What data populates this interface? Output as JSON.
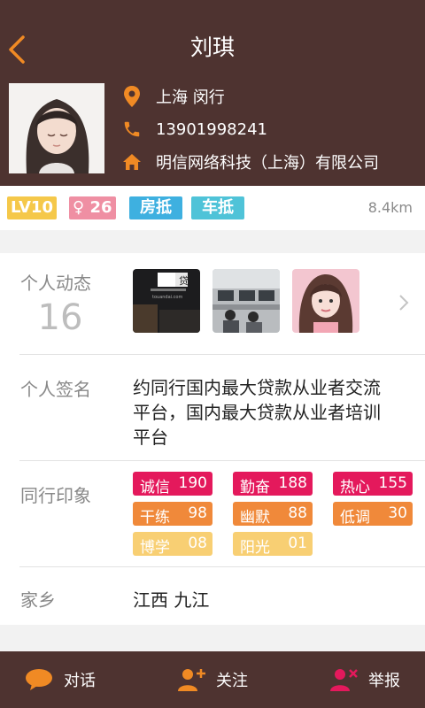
{
  "header": {
    "title": "刘琪"
  },
  "profile": {
    "location": "上海 闵行",
    "phone": "13901998241",
    "company": "明信网络科技（上海）有限公司"
  },
  "badges": {
    "level": "LV10",
    "gender_age": "♀ 26",
    "tag1": "房抵",
    "tag2": "车抵",
    "distance": "8.4km"
  },
  "activity": {
    "label": "个人动态",
    "count": "16",
    "thumb1_text": "贷",
    "thumb1_sub": "touandai.com"
  },
  "signature": {
    "label": "个人签名",
    "text": "约同行国内最大贷款从业者交流平台，国内最大贷款从业者培训平台"
  },
  "impressions": {
    "label": "同行印象",
    "tags": [
      {
        "name": "诚信",
        "count": "190",
        "color": "#e4195c"
      },
      {
        "name": "勤奋",
        "count": "188",
        "color": "#e4195c"
      },
      {
        "name": "热心",
        "count": "155",
        "color": "#e4195c"
      },
      {
        "name": "干练",
        "count": "98",
        "color": "#f0893a"
      },
      {
        "name": "幽默",
        "count": "88",
        "color": "#f0893a"
      },
      {
        "name": "低调",
        "count": "30",
        "color": "#f0893a"
      },
      {
        "name": "博学",
        "count": "08",
        "color": "#f8cf73"
      },
      {
        "name": "阳光",
        "count": "01",
        "color": "#f8cf73"
      }
    ]
  },
  "hometown": {
    "label": "家乡",
    "value": "江西 九江"
  },
  "footer": {
    "chat": "对话",
    "follow": "关注",
    "report": "举报"
  },
  "colors": {
    "brown": "#4e3330",
    "accent": "#f08a24",
    "blue": "#3eb0e0",
    "pink": "#ef8fa3",
    "gold": "#f5c84a"
  },
  "icons": [
    "back-arrow-icon",
    "location-pin-icon",
    "phone-icon",
    "home-icon",
    "chevron-right-icon",
    "chat-bubble-icon",
    "add-user-icon",
    "report-user-icon"
  ]
}
